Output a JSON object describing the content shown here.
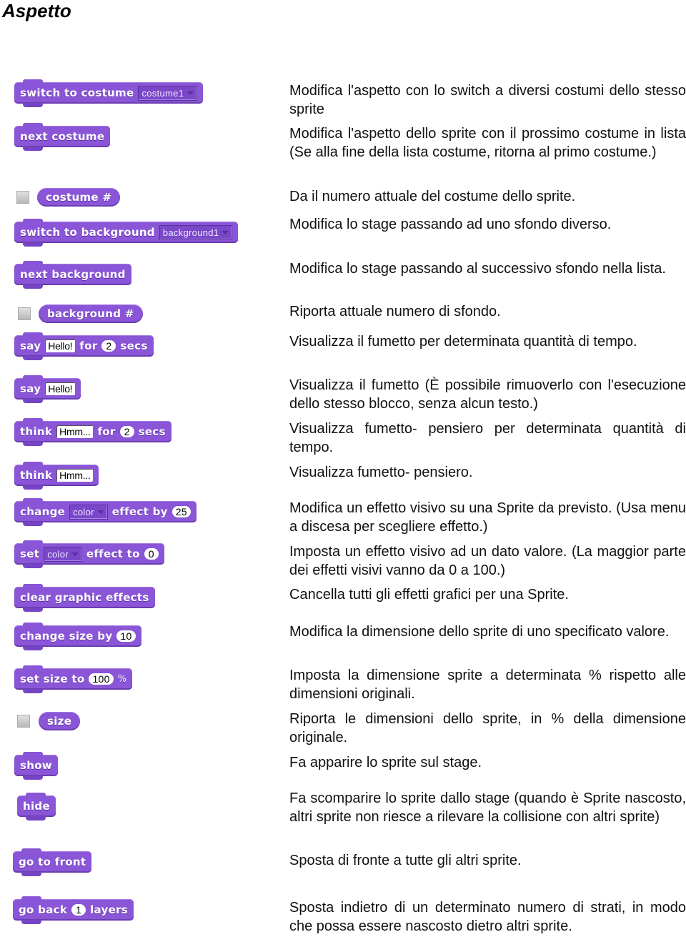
{
  "title": "Aspetto",
  "colors": {
    "block_purple": "#8a55d7",
    "text": "#111111"
  },
  "blocks": {
    "switch_costume": {
      "label": "switch to costume",
      "dropdown": "costume1"
    },
    "next_costume": {
      "label": "next costume"
    },
    "costume_num": {
      "label": "costume #"
    },
    "switch_background": {
      "label": "switch to background",
      "dropdown": "background1"
    },
    "next_background": {
      "label": "next background"
    },
    "background_num": {
      "label": "background #"
    },
    "say_for": {
      "say": "say",
      "text": "Hello!",
      "for": "for",
      "value": "2",
      "secs": "secs"
    },
    "say": {
      "say": "say",
      "text": "Hello!"
    },
    "think_for": {
      "think": "think",
      "text": "Hmm...",
      "for": "for",
      "value": "2",
      "secs": "secs"
    },
    "think": {
      "think": "think",
      "text": "Hmm..."
    },
    "change_effect": {
      "change": "change",
      "dropdown": "color",
      "effect_by": "effect by",
      "value": "25"
    },
    "set_effect": {
      "set": "set",
      "dropdown": "color",
      "effect_to": "effect to",
      "value": "0"
    },
    "clear_effects": {
      "label": "clear graphic effects"
    },
    "change_size": {
      "label": "change size by",
      "value": "10"
    },
    "set_size": {
      "label": "set size to",
      "value": "100",
      "unit": "%"
    },
    "size": {
      "label": "size"
    },
    "show": {
      "label": "show"
    },
    "hide": {
      "label": "hide"
    },
    "go_front": {
      "label": "go to front"
    },
    "go_back": {
      "go_back": "go back",
      "value": "1",
      "layers": "layers"
    }
  },
  "descriptions": [
    "Modifica l'aspetto con lo switch a diversi costumi dello stesso sprite",
    "Modifica l'aspetto dello sprite con il prossimo costume in lista (Se alla fine della lista costume, ritorna al primo costume.)",
    "Da il numero attuale del costume dello sprite.",
    "Modifica lo stage passando ad uno sfondo diverso.",
    "Modifica lo stage passando al successivo sfondo nella lista.",
    "Riporta  attuale numero di sfondo.",
    "Visualizza il fumetto per determinata quantità di tempo.",
    "Visualizza il fumetto  (È possibile rimuoverlo con l'esecuzione dello stesso blocco, senza alcun testo.)",
    "Visualizza fumetto- pensiero per determinata quantità di tempo.",
    "Visualizza fumetto- pensiero.",
    "Modifica un effetto visivo su una Sprite da previsto. (Usa menu a discesa per scegliere effetto.)",
    "Imposta un effetto visivo ad un dato valore. (La maggior parte dei effetti visivi vanno da 0 a 100.)",
    "Cancella tutti gli effetti grafici per una Sprite.",
    "Modifica la dimensione dello sprite di uno specificato valore.",
    "Imposta la dimensione sprite a determinata % rispetto alle dimensioni originali.",
    "Riporta le dimensioni dello sprite, in % della dimensione originale.",
    "Fa apparire lo sprite sul stage.",
    "Fa scomparire lo sprite dallo stage (quando è Sprite nascosto, altri sprite non riesce a rilevare la collisione con altri sprite)",
    "Sposta di fronte a tutte gli altri sprite.",
    "Sposta indietro di un determinato numero di strati, in modo che possa essere nascosto dietro altri sprite."
  ]
}
